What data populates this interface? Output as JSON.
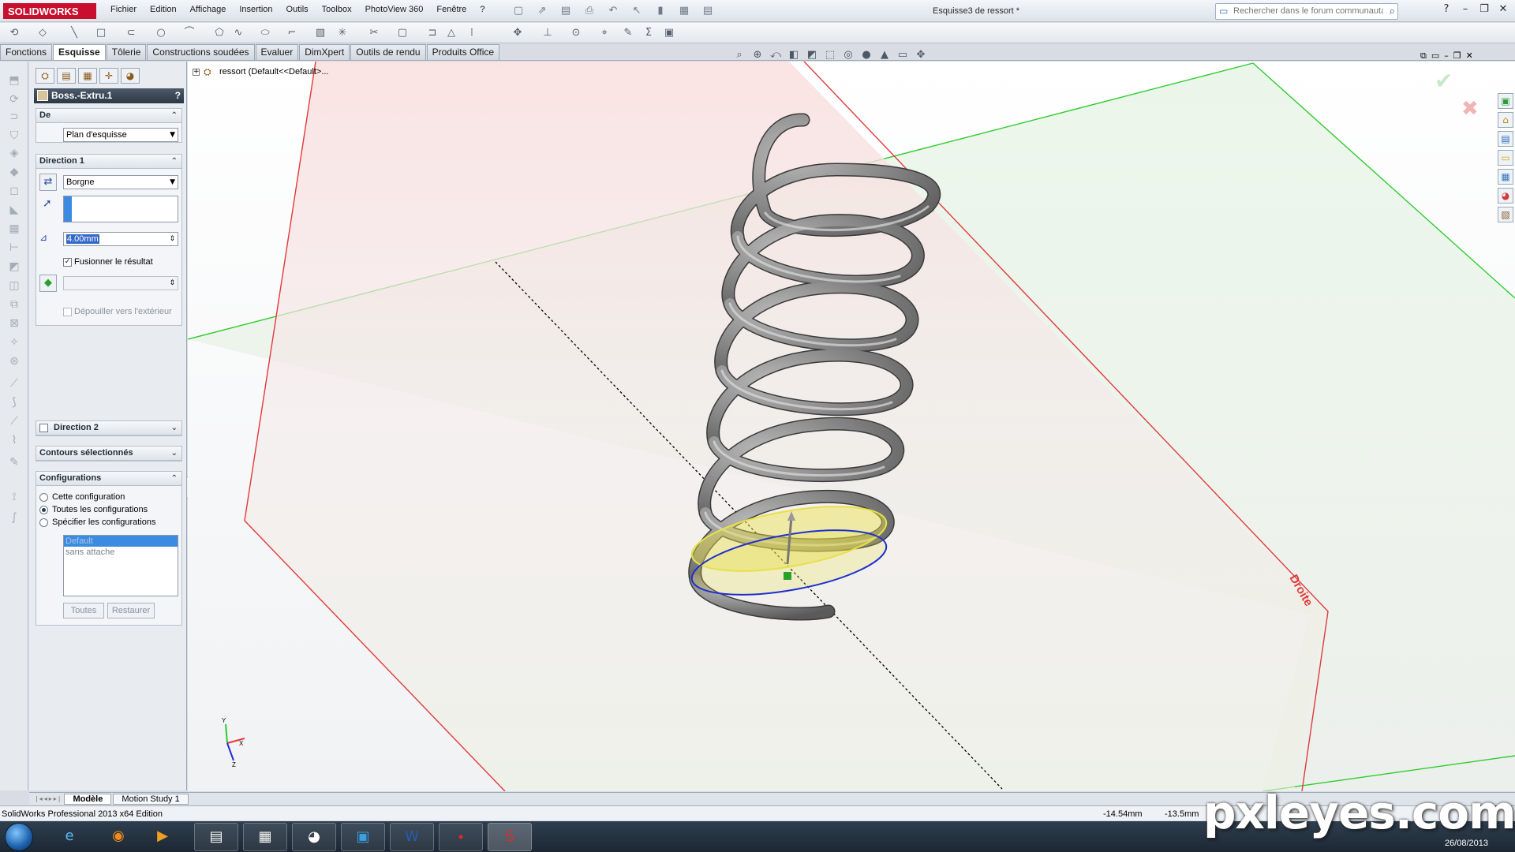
{
  "app": {
    "logo_text": "SOLIDWORKS",
    "menu": [
      "Fichier",
      "Edition",
      "Affichage",
      "Insertion",
      "Outils",
      "Toolbox",
      "PhotoView 360",
      "Fenêtre",
      "?"
    ],
    "document_title": "Esquisse3 de ressort *",
    "search_placeholder": "Rechercher dans le forum communautaire"
  },
  "tabs": [
    "Fonctions",
    "Esquisse",
    "Tôlerie",
    "Constructions soudées",
    "Evaluer",
    "DimXpert",
    "Outils de rendu",
    "Produits Office"
  ],
  "active_tab": "Esquisse",
  "property_manager": {
    "title": "Boss.-Extru.1",
    "help": "?",
    "from_group": {
      "label": "De",
      "value": "Plan d'esquisse"
    },
    "direction1": {
      "label": "Direction 1",
      "end_condition": "Borgne",
      "depth": "4.00mm",
      "merge_label": "Fusionner le résultat",
      "merge_checked": true,
      "draft_label": "Dépouiller vers l'extérieur",
      "draft_checked": false
    },
    "direction2": {
      "label": "Direction 2"
    },
    "contours": {
      "label": "Contours sélectionnés"
    },
    "configurations": {
      "label": "Configurations",
      "options": [
        "Cette configuration",
        "Toutes les configurations",
        "Spécifier les configurations"
      ],
      "selected_index": 1,
      "list": [
        "Default",
        "sans attache"
      ],
      "btn_all": "Toutes",
      "btn_restore": "Restaurer"
    }
  },
  "tree": {
    "label": "ressort  (Default<<Default>..."
  },
  "viewport": {
    "plane_label": "Droite",
    "colors": {
      "front_plane": "#e23a3a",
      "top_plane": "#2ecc2e",
      "spring": "#8a8a8a",
      "profile_yellow": "#e8e04a",
      "profile_blue": "#1f2fd0"
    }
  },
  "bottom_tabs": [
    "Modèle",
    "Motion Study 1"
  ],
  "status": {
    "text": "SolidWorks Professional 2013 x64 Edition",
    "x": "-14.54mm",
    "y": "-13.5mm"
  },
  "taskbar": {
    "date": "26/08/2013"
  },
  "watermark": "pxleyes.com"
}
